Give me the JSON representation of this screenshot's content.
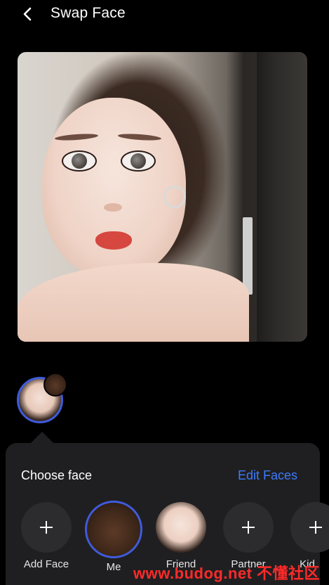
{
  "header": {
    "title": "Swap Face",
    "back_icon": "chevron-left-icon"
  },
  "colors": {
    "accent": "#3c7bff",
    "ring": "#3f5bdc",
    "sheet": "#1f1f21",
    "background": "#000000",
    "watermark": "#ff2a2a"
  },
  "choose": {
    "label": "Choose face",
    "edit_label": "Edit Faces"
  },
  "faces": [
    {
      "label": "Add Face",
      "type": "add"
    },
    {
      "label": "Me",
      "type": "photo",
      "selected": true
    },
    {
      "label": "Friend",
      "type": "photo"
    },
    {
      "label": "Partner",
      "type": "add"
    },
    {
      "label": "Kid",
      "type": "add"
    }
  ],
  "watermark": "www.budog.net 不懂社区"
}
